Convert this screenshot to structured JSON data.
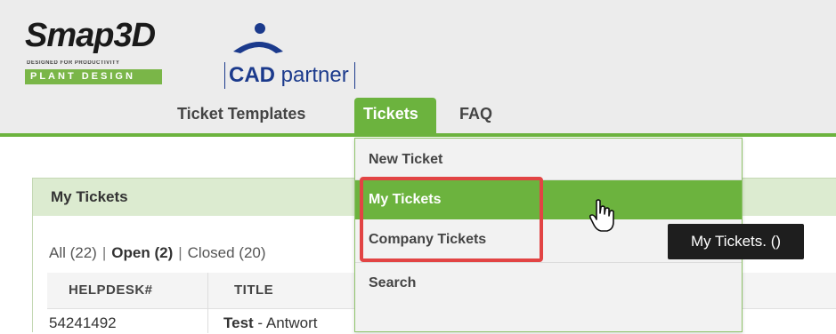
{
  "brand": {
    "smap_word": "Smap3D",
    "smap_tagline": "DESIGNED FOR PRODUCTIVITY",
    "smap_subtitle": "PLANT DESIGN",
    "cad_bold": "CAD",
    "cad_light": " partner"
  },
  "nav": {
    "ticket_templates": "Ticket Templates",
    "tickets": "Tickets",
    "faq": "FAQ"
  },
  "dropdown": {
    "items": [
      "New Ticket",
      "My Tickets",
      "Company Tickets",
      "Search"
    ],
    "active_index": 1
  },
  "tooltip": "My Tickets. ()",
  "panel": {
    "title": "My Tickets",
    "filters": {
      "all": "All (22)",
      "open": "Open (2)",
      "closed": "Closed (20)",
      "separator": "|"
    },
    "columns": [
      "HELPDESK#",
      "TITLE"
    ],
    "rows": [
      {
        "helpdesk": "54241492",
        "title": "Test",
        "title_suffix": " - Antwort"
      }
    ]
  },
  "colors": {
    "accent": "#6cb33e",
    "header_bg": "#ececec",
    "panel_header_bg": "#dcebd0",
    "highlight": "#e24444",
    "brand_blue": "#1b3a8c"
  }
}
